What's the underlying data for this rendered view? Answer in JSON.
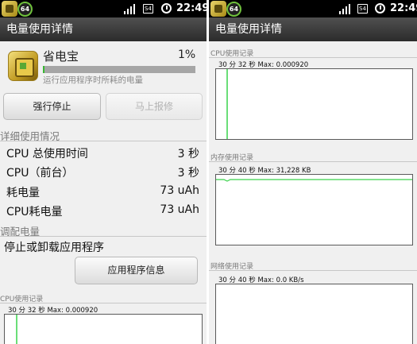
{
  "status_bar": {
    "badge": "64",
    "sim_label": "S4",
    "time": "22:49"
  },
  "left": {
    "title": "电量使用详情",
    "app": {
      "name": "省电宝",
      "percent": "1%",
      "usage_fraction": 0.01,
      "subtitle": "运行应用程序时所耗的电量"
    },
    "buttons": {
      "force_stop": "强行停止",
      "report": "马上报修"
    },
    "details_header": "详细使用情况",
    "stats": [
      {
        "label": "CPU 总使用时间",
        "value": "3 秒"
      },
      {
        "label": "CPU（前台）",
        "value": "3 秒"
      },
      {
        "label": "耗电量",
        "value": "73 uAh"
      },
      {
        "label": "CPU耗电量",
        "value": "73 uAh"
      }
    ],
    "adjust_header": "调配电量",
    "adjust_text": "停止或卸载应用程序",
    "app_info_button": "应用程序信息",
    "cpu_graph": {
      "caption": "CPU使用记录",
      "meta": "30 分 32 秒 Max: 0.000920",
      "line_color": "#39d24a"
    }
  },
  "right": {
    "title": "电量使用详情",
    "graphs": [
      {
        "caption": "CPU使用记录",
        "meta": "30 分 32 秒 Max: 0.000920",
        "kind": "cpu"
      },
      {
        "caption": "内存使用记录",
        "meta": "30 分 40 秒 Max: 31,228 KB",
        "kind": "memory"
      },
      {
        "caption": "网络使用记录",
        "meta": "30 分 40 秒 Max: 0.0 KB/s",
        "kind": "network"
      }
    ],
    "line_color": "#39d24a"
  }
}
